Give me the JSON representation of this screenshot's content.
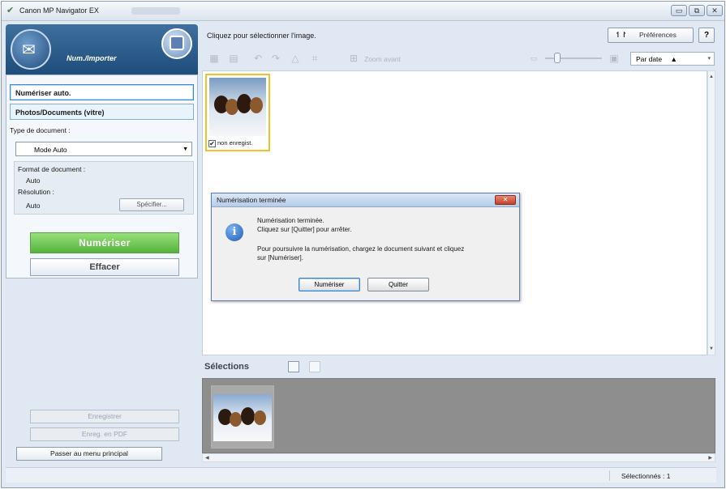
{
  "window": {
    "title": "Canon MP Navigator EX",
    "controls": {
      "minimize": "▭",
      "maximize": "⧉",
      "close": "✕"
    }
  },
  "left_panel": {
    "mode_title": "Num./Importer",
    "buttons": {
      "auto_scan": "Numériser auto.",
      "photos_docs": "Photos/Documents (vitre)"
    },
    "doc_type_label": "Type de document :",
    "doc_type_value": "Mode Auto",
    "format_label": "Format de document :",
    "format_value": "Auto",
    "resolution_label": "Résolution :",
    "resolution_value": "Auto",
    "specify_button": "Spécifier...",
    "scan_button": "Numériser",
    "clear_button": "Effacer",
    "save_button": "Enregistrer",
    "save_pdf_button": "Enreg. en PDF",
    "main_menu_button": "Passer au menu principal"
  },
  "right_panel": {
    "hint": "Cliquez pour sélectionner l'image.",
    "preferences_button": "Préférences",
    "preferences_icon": "↿↾",
    "help_button": "?",
    "zoom_label": "Zoom avant",
    "sort_value": "Par date",
    "sort_arrow": "▲",
    "thumbnail_caption": "non enregist.",
    "selections_title": "Sélections"
  },
  "dialog": {
    "title": "Numérisation terminée",
    "close": "✕",
    "info_icon": "i",
    "line1": "Numérisation terminée.",
    "line2": "Cliquez sur [Quitter] pour arrêter.",
    "line3": "Pour poursuivre la numérisation, chargez le document suivant et cliquez",
    "line4": "sur [Numériser].",
    "scan_button": "Numériser",
    "quit_button": "Quitter"
  },
  "status": {
    "selected": "Sélectionnés : 1"
  },
  "icons": {
    "app": "app-logo-icon",
    "scanner": "scanner-icon",
    "menu": "main-menu-icon",
    "info": "info-icon"
  },
  "colors": {
    "header": "#1e4d7c",
    "scan_button": "#54b33c",
    "thumb_border": "#f1c12c",
    "tray": "#8e8e8e"
  }
}
